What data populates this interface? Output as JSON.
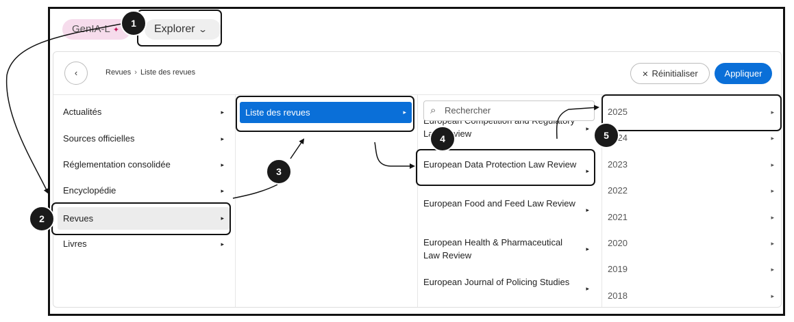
{
  "topbar": {
    "genia_label": "GenIA-L",
    "genia_star": "✦",
    "explorer_label": "Explorer",
    "explorer_chevron": "⌄"
  },
  "header": {
    "back_icon": "‹",
    "breadcrumb": [
      "Revues",
      "Liste des revues"
    ],
    "breadcrumb_sep": "›",
    "reset_label": "Réinitialiser",
    "reset_icon": "✕",
    "apply_label": "Appliquer"
  },
  "colors": {
    "accent": "#0a6fd8",
    "badge": "#1a1a1a",
    "genia_bg": "#f6dcec"
  },
  "column1": {
    "items": [
      {
        "label": "Actualités"
      },
      {
        "label": "Sources officielles"
      },
      {
        "label": "Réglementation consolidée"
      },
      {
        "label": "Encyclopédie"
      },
      {
        "label": "Revues",
        "selected": true
      },
      {
        "label": "Livres"
      }
    ]
  },
  "column2": {
    "items": [
      {
        "label": "Liste des revues",
        "selected": true
      }
    ]
  },
  "column3": {
    "search_placeholder": "Rechercher",
    "items": [
      {
        "label": "European Competition and Regulatory Law Review"
      },
      {
        "label": "European Data Protection Law Review"
      },
      {
        "label": "European Food and Feed Law Review"
      },
      {
        "label": "European Health & Pharmaceutical Law Review"
      },
      {
        "label": "European Journal of Policing Studies"
      }
    ]
  },
  "column4": {
    "items": [
      {
        "label": "2025"
      },
      {
        "label": "2024"
      },
      {
        "label": "2023"
      },
      {
        "label": "2022"
      },
      {
        "label": "2021"
      },
      {
        "label": "2020"
      },
      {
        "label": "2019"
      },
      {
        "label": "2018"
      }
    ]
  },
  "steps": [
    "1",
    "2",
    "3",
    "4",
    "5"
  ],
  "arrow_glyph": "▸"
}
